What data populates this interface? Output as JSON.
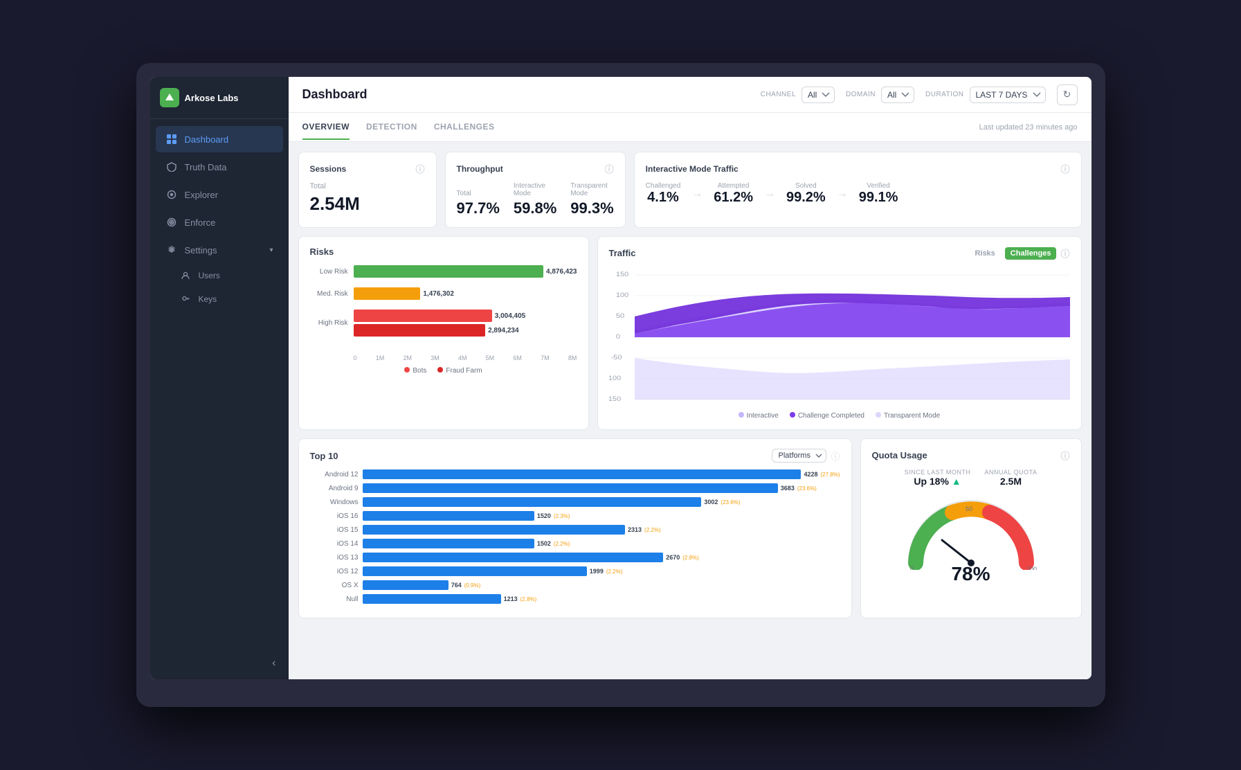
{
  "app": {
    "name": "Arkose Labs",
    "logo_letter": "A"
  },
  "sidebar": {
    "items": [
      {
        "id": "dashboard",
        "label": "Dashboard",
        "active": true,
        "icon": "grid"
      },
      {
        "id": "truth-data",
        "label": "Truth Data",
        "active": false,
        "icon": "shield"
      },
      {
        "id": "explorer",
        "label": "Explorer",
        "active": false,
        "icon": "compass"
      },
      {
        "id": "enforce",
        "label": "Enforce",
        "active": false,
        "icon": "target"
      },
      {
        "id": "settings",
        "label": "Settings",
        "active": false,
        "icon": "gear"
      },
      {
        "id": "users",
        "label": "Users",
        "active": false,
        "icon": "user",
        "sub": true
      },
      {
        "id": "keys",
        "label": "Keys",
        "active": false,
        "icon": "key",
        "sub": true
      }
    ],
    "collapse_icon": "‹"
  },
  "header": {
    "title": "Dashboard",
    "filters": {
      "channel_label": "CHANNEL",
      "channel_value": "All",
      "domain_label": "DOMAIN",
      "domain_value": "All",
      "duration_label": "DURATION",
      "duration_value": "LAST 7 DAYS"
    },
    "last_updated": "Last updated 23 minutes ago"
  },
  "tabs": [
    {
      "id": "overview",
      "label": "OVERVIEW",
      "active": true
    },
    {
      "id": "detection",
      "label": "DETECTION",
      "active": false
    },
    {
      "id": "challenges",
      "label": "CHALLENGES",
      "active": false
    }
  ],
  "sessions": {
    "title": "Sessions",
    "total_label": "Total",
    "total_value": "2.54M"
  },
  "throughput": {
    "title": "Throughput",
    "total_label": "Total",
    "total_value": "97.7%",
    "interactive_label": "Interactive Mode",
    "interactive_value": "59.8%",
    "transparent_label": "Transparent Mode",
    "transparent_value": "99.3%"
  },
  "interactive_mode": {
    "title": "Interactive Mode Traffic",
    "challenged_label": "Challenged",
    "challenged_value": "4.1%",
    "attempted_label": "Attempted",
    "attempted_value": "61.2%",
    "solved_label": "Solved",
    "solved_value": "99.2%",
    "verified_label": "Verified",
    "verified_value": "99.1%"
  },
  "risks": {
    "title": "Risks",
    "bars": [
      {
        "label": "Low Risk",
        "value1": 4876423,
        "value1_fmt": "4,876,423",
        "pct1": 100,
        "color1": "green"
      },
      {
        "label": "Med. Risk",
        "value1": 1476302,
        "value1_fmt": "1,476,302",
        "pct1": 30,
        "color1": "yellow"
      },
      {
        "label": "High Risk",
        "value1": 3004405,
        "value1_fmt": "3,004,405",
        "pct1": 62,
        "color1": "red",
        "value2": 2894234,
        "value2_fmt": "2,894,234",
        "pct2": 59,
        "color2": "darkred"
      }
    ],
    "legend": [
      {
        "label": "Bots",
        "color": "#ef4444"
      },
      {
        "label": "Fraud Farm",
        "color": "#dc2626"
      }
    ],
    "x_labels": [
      "0",
      "1M",
      "2M",
      "3M",
      "4M",
      "5M",
      "6M",
      "7M",
      "8M"
    ]
  },
  "traffic": {
    "title": "Traffic",
    "btn_risks": "Risks",
    "btn_challenges": "Challenges",
    "y_labels": [
      "150",
      "100",
      "50",
      "0",
      "-50",
      "-100",
      "-150"
    ],
    "legend": [
      {
        "label": "Interactive",
        "color": "#c4b5fd"
      },
      {
        "label": "Challenge Completed",
        "color": "#7c3aed"
      },
      {
        "label": "Transparent Mode",
        "color": "#ddd6fe"
      }
    ]
  },
  "top10": {
    "title": "Top 10",
    "dropdown_label": "Platforms",
    "bars": [
      {
        "label": "Android 12",
        "value": 4228,
        "value_fmt": "4228",
        "pct": "27.8%",
        "width_pct": 100
      },
      {
        "label": "Android 9",
        "value": 3683,
        "value_fmt": "3683",
        "pct": "23.6%",
        "width_pct": 87
      },
      {
        "label": "Windows",
        "value": 3002,
        "value_fmt": "3002",
        "pct": "23.6%",
        "width_pct": 71
      },
      {
        "label": "iOS 16",
        "value": 1520,
        "value_fmt": "1520",
        "pct": "2.3%",
        "width_pct": 36
      },
      {
        "label": "iOS 15",
        "value": 2313,
        "value_fmt": "2313",
        "pct": "2.2%",
        "width_pct": 55
      },
      {
        "label": "iOS 14",
        "value": 1502,
        "value_fmt": "1502",
        "pct": "2.2%",
        "width_pct": 36
      },
      {
        "label": "iOS 13",
        "value": 2670,
        "value_fmt": "2670",
        "pct": "2.8%",
        "width_pct": 63
      },
      {
        "label": "iOS 12",
        "value": 1999,
        "value_fmt": "1999",
        "pct": "2.2%",
        "width_pct": 47
      },
      {
        "label": "OS X",
        "value": 764,
        "value_fmt": "764",
        "pct": "0.9%",
        "width_pct": 18
      },
      {
        "label": "Null",
        "value": 1213,
        "value_fmt": "1213",
        "pct": "2.8%",
        "width_pct": 29
      }
    ]
  },
  "quota": {
    "title": "Quota Usage",
    "since_label": "SINCE LAST MONTH",
    "since_value": "Up 18%",
    "since_arrow": "▲",
    "annual_label": "ANNUAL QUOTA",
    "annual_value": "2.5M",
    "percentage": 78,
    "percentage_fmt": "78%",
    "gauge_min": "0",
    "gauge_max": "100",
    "gauge_mid": "50"
  }
}
